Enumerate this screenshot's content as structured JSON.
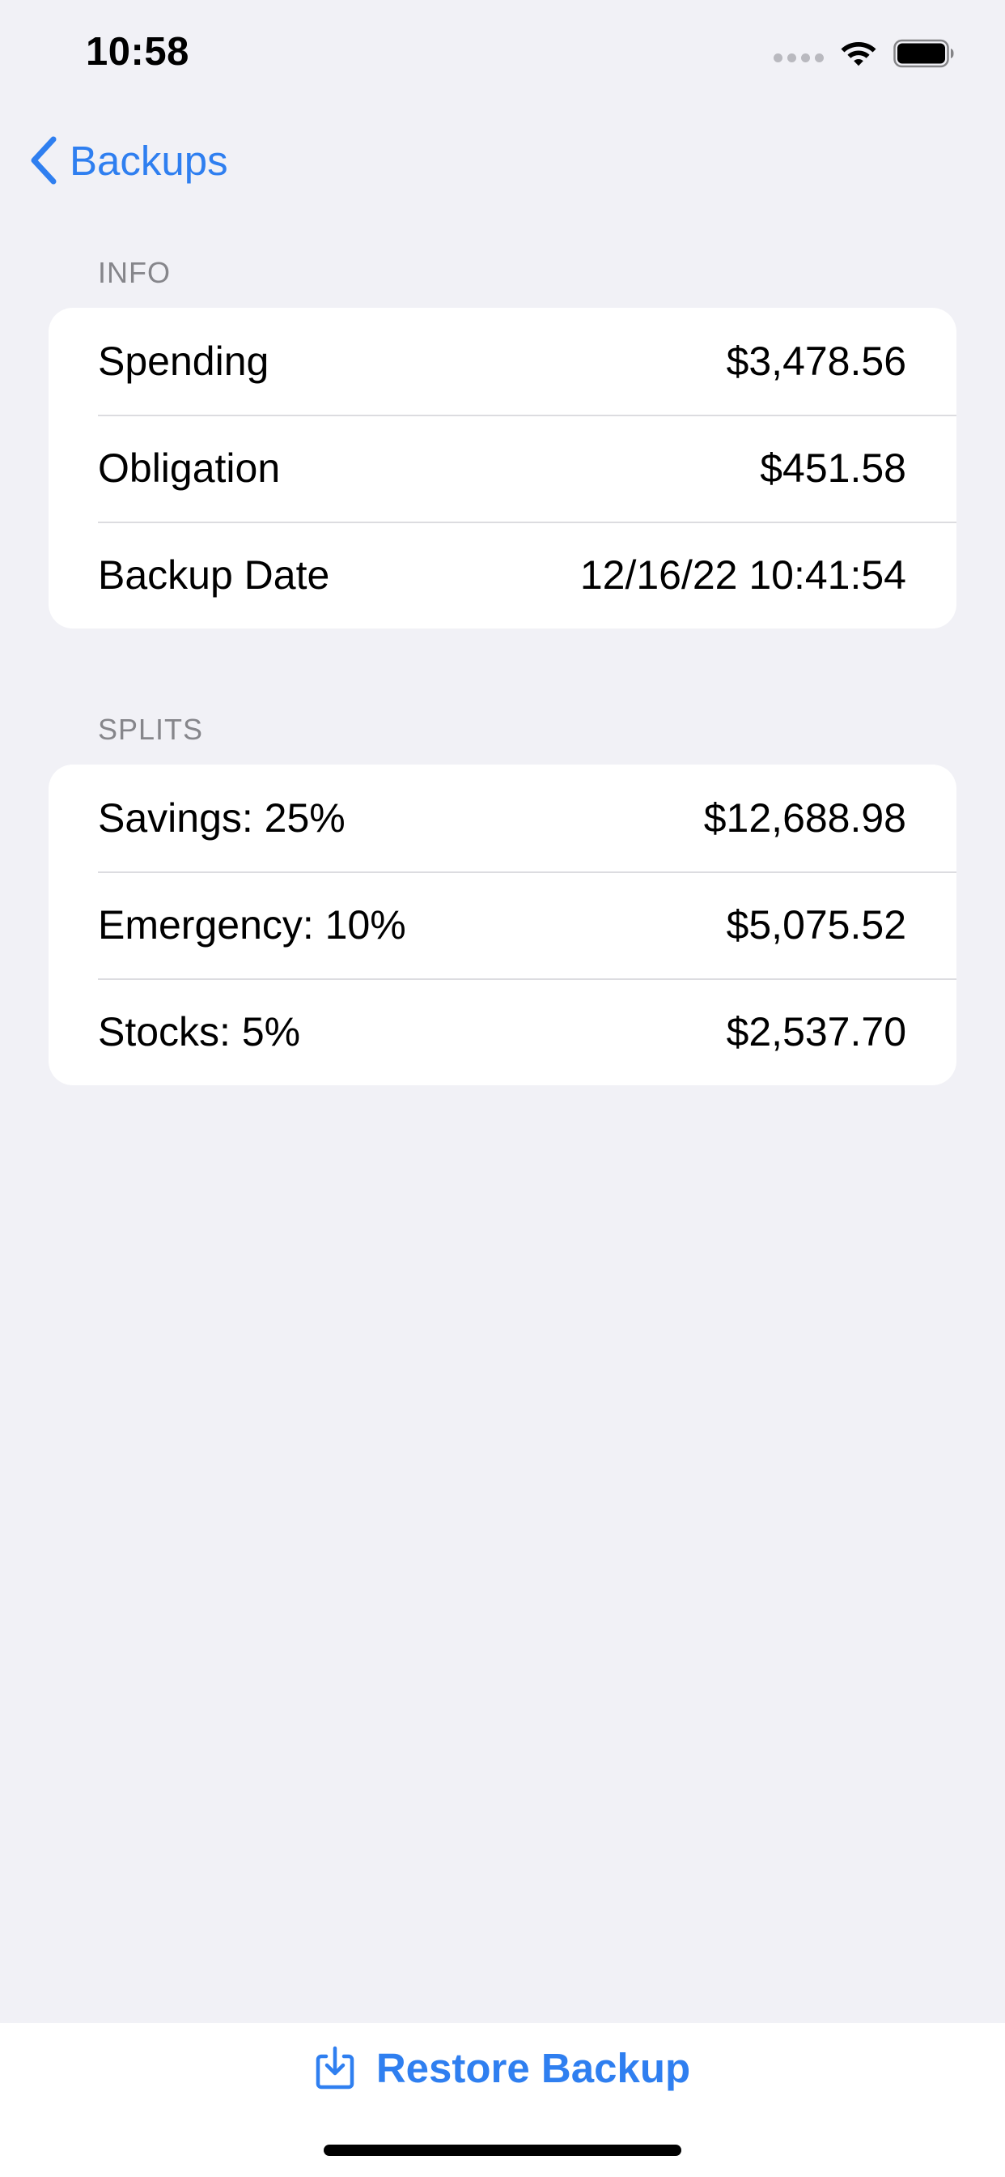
{
  "status_bar": {
    "time": "10:58",
    "icons": [
      "cellular-dots-icon",
      "wifi-icon",
      "battery-icon"
    ]
  },
  "nav": {
    "back_label": "Backups",
    "back_icon": "chevron-left-icon"
  },
  "sections": {
    "info": {
      "header": "INFO",
      "rows": [
        {
          "label": "Spending",
          "value": "$3,478.56"
        },
        {
          "label": "Obligation",
          "value": "$451.58"
        },
        {
          "label": "Backup Date",
          "value": "12/16/22 10:41:54"
        }
      ]
    },
    "splits": {
      "header": "SPLITS",
      "rows": [
        {
          "label": "Savings: 25%",
          "value": "$12,688.98"
        },
        {
          "label": "Emergency: 10%",
          "value": "$5,075.52"
        },
        {
          "label": "Stocks: 5%",
          "value": "$2,537.70"
        }
      ]
    }
  },
  "toolbar": {
    "restore_label": "Restore Backup",
    "restore_icon": "tray-download-icon"
  },
  "colors": {
    "accent": "#2f7ff0",
    "background": "#f1f1f6",
    "card": "#ffffff",
    "secondary_text": "#86868b"
  }
}
